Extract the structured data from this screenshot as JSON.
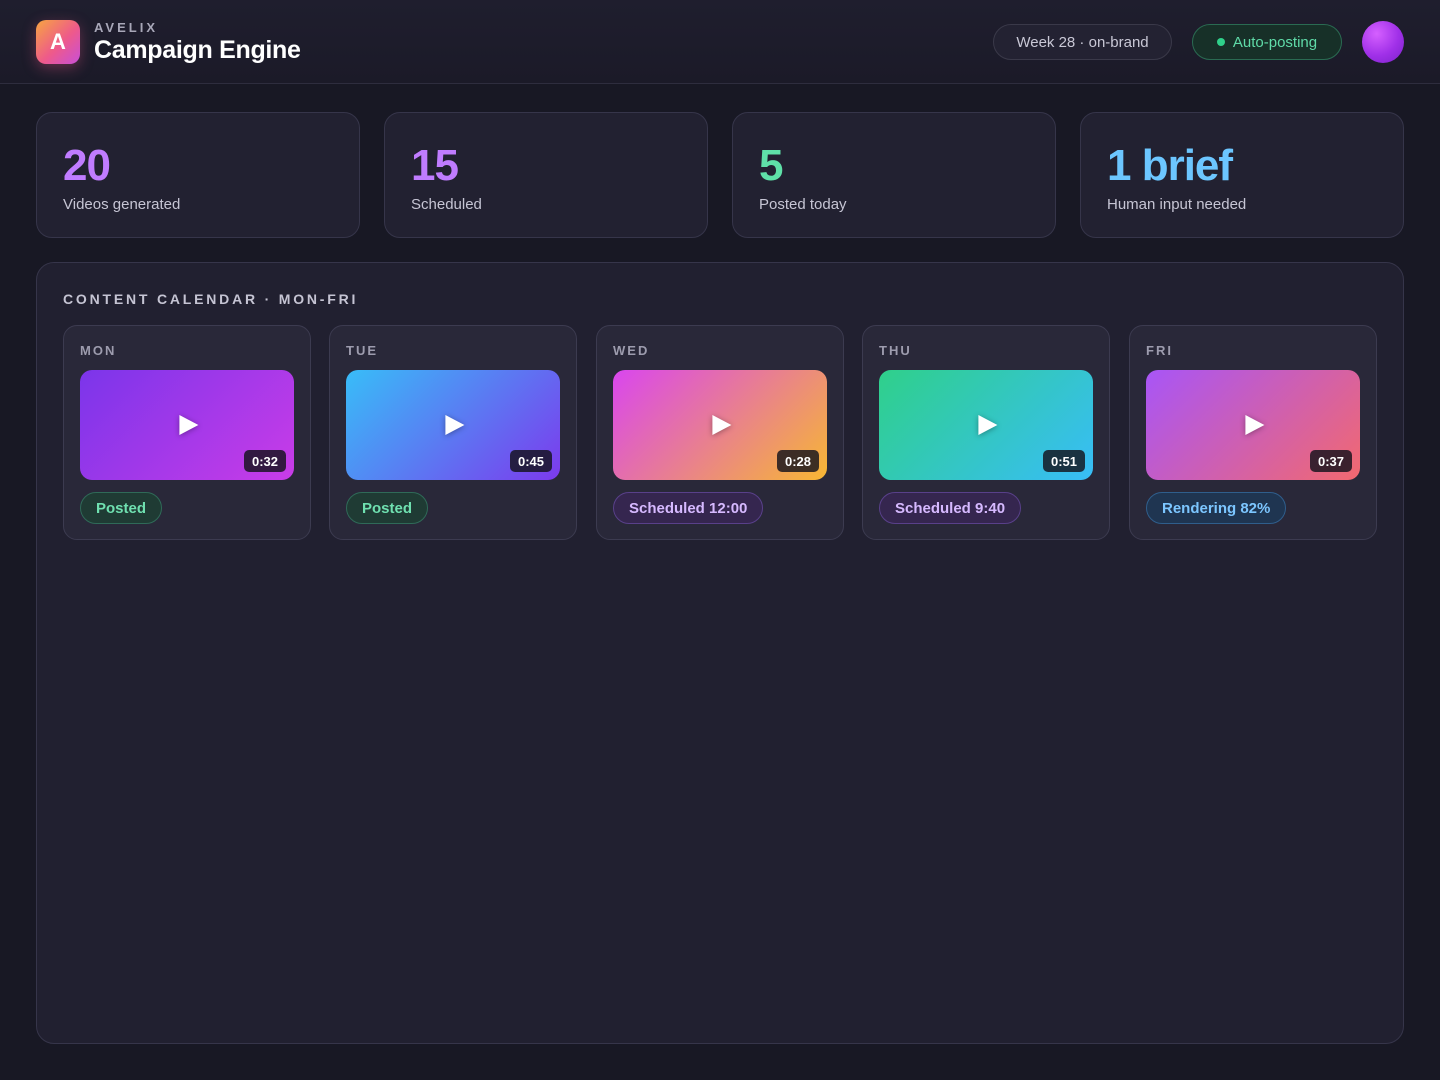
{
  "header": {
    "logo_letter": "A",
    "brand_eyebrow": "AVELIX",
    "brand_title": "Campaign Engine",
    "week_pill": "Week 28 · on-brand",
    "status_pill": "Auto-posting",
    "status_color": "#2fd08a"
  },
  "stats": [
    {
      "value": "20",
      "label": "Videos generated",
      "color": "#c07cff"
    },
    {
      "value": "15",
      "label": "Scheduled",
      "color": "#c07cff"
    },
    {
      "value": "5",
      "label": "Posted today",
      "color": "#5fe0a8"
    },
    {
      "value": "1 brief",
      "label": "Human input needed",
      "color": "#6cc6ff"
    }
  ],
  "calendar": {
    "heading": "CONTENT CALENDAR · MON-FRI",
    "days": [
      {
        "day": "MON",
        "duration": "0:32",
        "status": "Posted",
        "status_type": "posted",
        "thumb_colors": [
          "#7b35ea",
          "#c93ce8"
        ]
      },
      {
        "day": "TUE",
        "duration": "0:45",
        "status": "Posted",
        "status_type": "posted",
        "thumb_colors": [
          "#38bdf8",
          "#7c3aed"
        ]
      },
      {
        "day": "WED",
        "duration": "0:28",
        "status": "Scheduled 12:00",
        "status_type": "scheduled",
        "thumb_colors": [
          "#d946ef",
          "#f7b733"
        ]
      },
      {
        "day": "THU",
        "duration": "0:51",
        "status": "Scheduled 9:40",
        "status_type": "scheduled",
        "thumb_colors": [
          "#2fd08a",
          "#38bdf8"
        ]
      },
      {
        "day": "FRI",
        "duration": "0:37",
        "status": "Rendering 82%",
        "status_type": "rendering",
        "thumb_colors": [
          "#a855f7",
          "#f2696f"
        ]
      }
    ]
  }
}
